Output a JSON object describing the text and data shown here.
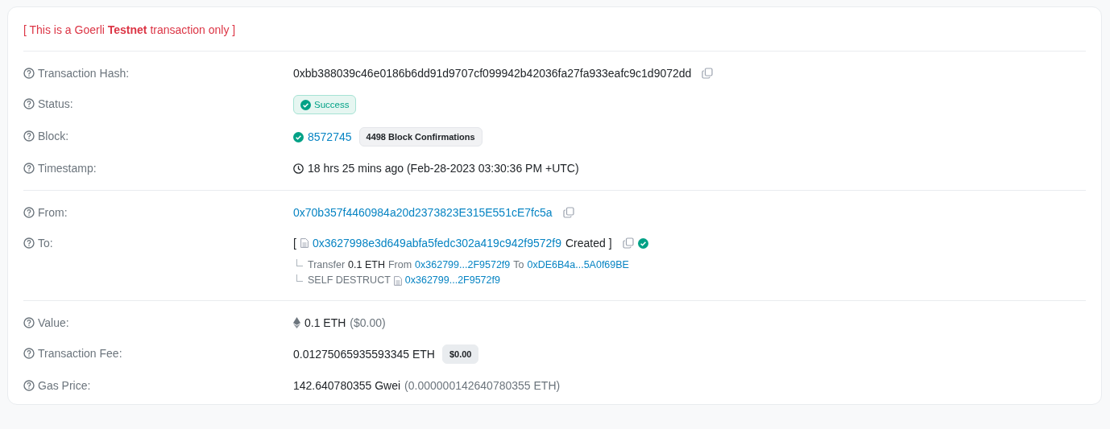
{
  "notice": "[ This is a Goerli **Testnet** transaction only ]",
  "sections": [
    {
      "rows": [
        {
          "label": "Transaction Hash:",
          "lines": [
            [
              {
                "kind": "text",
                "text": "0xbb388039c46e0186b6dd91d9707cf099942b42036fa27fa933eafc9c1d9072dd"
              },
              {
                "kind": "copy"
              }
            ]
          ]
        },
        {
          "label": "Status:",
          "lines": [
            [
              {
                "kind": "success",
                "text": "Success"
              }
            ]
          ]
        },
        {
          "label": "Block:",
          "lines": [
            [
              {
                "kind": "check"
              },
              {
                "kind": "link",
                "text": "8572745"
              },
              {
                "kind": "pill",
                "text": "4498 Block Confirmations"
              }
            ]
          ]
        },
        {
          "label": "Timestamp:",
          "lines": [
            [
              {
                "kind": "clock"
              },
              {
                "kind": "text",
                "text": "18 hrs 25 mins ago (Feb-28-2023 03:30:36 PM +UTC)"
              }
            ]
          ]
        }
      ]
    },
    {
      "rows": [
        {
          "label": "From:",
          "lines": [
            [
              {
                "kind": "link",
                "text": "0x70b357f4460984a20d2373823E315E551cE7fc5a"
              },
              {
                "kind": "copy"
              }
            ]
          ]
        },
        {
          "label": "To:",
          "lines": [
            [
              {
                "kind": "text",
                "text": "["
              },
              {
                "kind": "doc"
              },
              {
                "kind": "link",
                "text": "0x3627998e3d649abfa5fedc302a419c942f9572f9"
              },
              {
                "kind": "text",
                "text": "Created ]"
              },
              {
                "kind": "copy"
              },
              {
                "kind": "check"
              }
            ],
            [
              {
                "kind": "branch"
              },
              {
                "kind": "muted",
                "text": "Transfer"
              },
              {
                "kind": "text",
                "text": "0.1 ETH"
              },
              {
                "kind": "muted",
                "text": "From"
              },
              {
                "kind": "link",
                "text": "0x362799...2F9572f9"
              },
              {
                "kind": "muted",
                "text": "To"
              },
              {
                "kind": "link",
                "text": "0xDE6B4a...5A0f69BE"
              }
            ],
            [
              {
                "kind": "branch"
              },
              {
                "kind": "muted",
                "text": "SELF DESTRUCT"
              },
              {
                "kind": "doc"
              },
              {
                "kind": "link",
                "text": "0x362799...2F9572f9"
              }
            ]
          ]
        }
      ]
    },
    {
      "rows": [
        {
          "label": "Value:",
          "lines": [
            [
              {
                "kind": "eth"
              },
              {
                "kind": "text",
                "text": "0.1 ETH"
              },
              {
                "kind": "muted",
                "text": "($0.00)"
              }
            ]
          ]
        },
        {
          "label": "Transaction Fee:",
          "lines": [
            [
              {
                "kind": "text",
                "text": "0.01275065935593345 ETH"
              },
              {
                "kind": "pill",
                "text": "$0.00"
              }
            ]
          ]
        },
        {
          "label": "Gas Price:",
          "lines": [
            [
              {
                "kind": "text",
                "text": "142.640780355 Gwei"
              },
              {
                "kind": "muted",
                "text": "(0.000000142640780355 ETH)"
              }
            ]
          ]
        }
      ]
    }
  ]
}
